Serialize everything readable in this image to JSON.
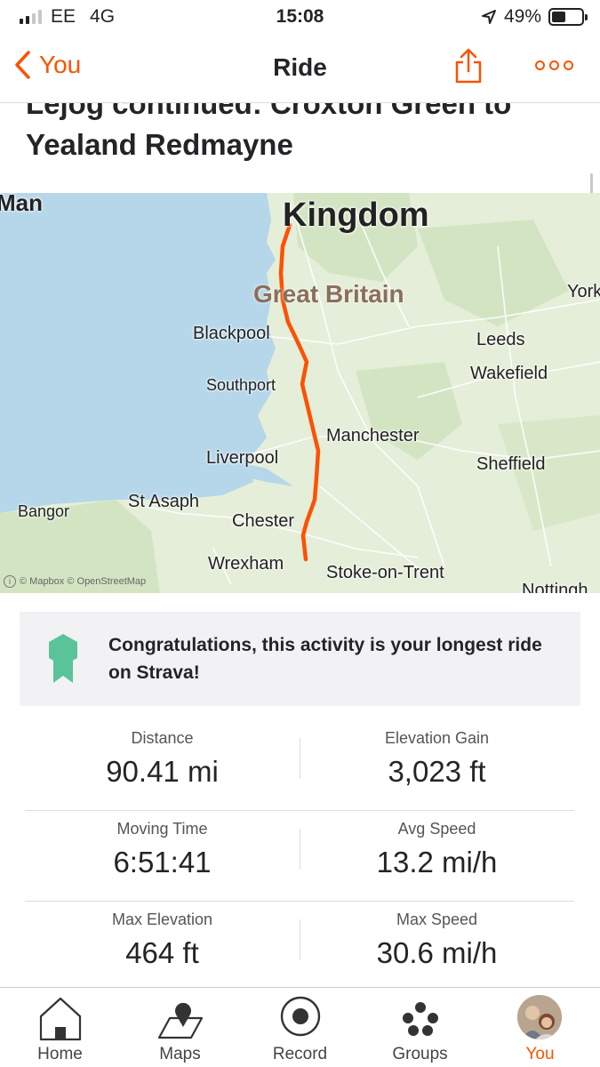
{
  "status_bar": {
    "carrier": "EE",
    "network": "4G",
    "time": "15:08",
    "battery": "49%",
    "battery_level": 0.49
  },
  "nav": {
    "back_label": "You",
    "title": "Ride"
  },
  "activity": {
    "title": "Lejog continued: Croxton Green to Yealand Redmayne"
  },
  "map": {
    "labels": {
      "man": "Man",
      "kingdom": "Kingdom",
      "great_britain": "Great Britain",
      "york": "York",
      "blackpool": "Blackpool",
      "leeds": "Leeds",
      "wakefield": "Wakefield",
      "southport": "Southport",
      "manchester": "Manchester",
      "liverpool": "Liverpool",
      "sheffield": "Sheffield",
      "bangor": "Bangor",
      "st_asaph": "St Asaph",
      "chester": "Chester",
      "wrexham": "Wrexham",
      "stoke": "Stoke-on-Trent",
      "nottingham": "Nottingh"
    },
    "attribution": "© Mapbox © OpenStreetMap",
    "route_color": "#fc5200"
  },
  "achievement": {
    "text": "Congratulations, this activity is your longest ride on Strava!",
    "badge_color": "#5bc39a"
  },
  "stats": [
    {
      "left_label": "Distance",
      "left_value": "90.41 mi",
      "right_label": "Elevation Gain",
      "right_value": "3,023 ft"
    },
    {
      "left_label": "Moving Time",
      "left_value": "6:51:41",
      "right_label": "Avg Speed",
      "right_value": "13.2 mi/h"
    },
    {
      "left_label": "Max Elevation",
      "left_value": "464 ft",
      "right_label": "Max Speed",
      "right_value": "30.6 mi/h"
    }
  ],
  "tabs": [
    {
      "label": "Home",
      "icon": "home-icon"
    },
    {
      "label": "Maps",
      "icon": "map-pin-icon"
    },
    {
      "label": "Record",
      "icon": "record-icon"
    },
    {
      "label": "Groups",
      "icon": "groups-icon"
    },
    {
      "label": "You",
      "icon": "avatar",
      "active": true
    }
  ],
  "colors": {
    "accent": "#fc5200",
    "text": "#242428",
    "water": "#b6d6ea",
    "land": "#e4eed9"
  }
}
